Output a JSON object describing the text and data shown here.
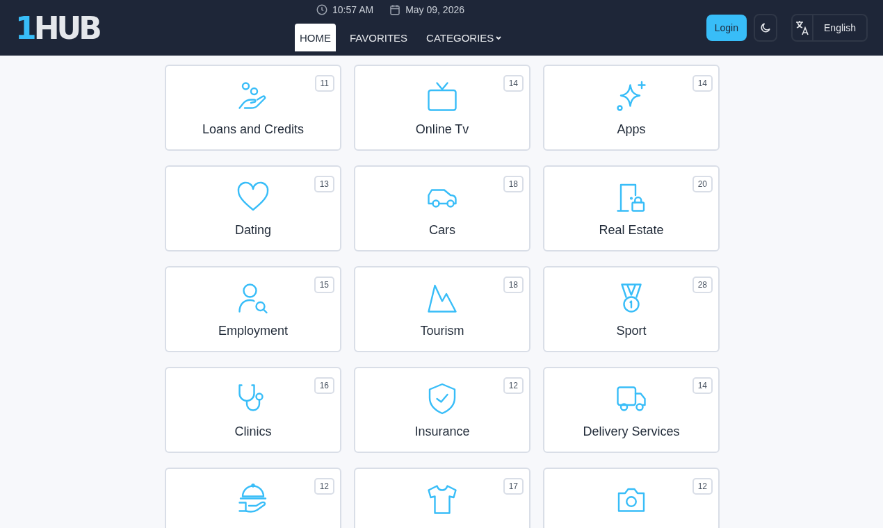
{
  "header": {
    "logo": {
      "accent": "1",
      "text": "HUB"
    },
    "time": "10:57 AM",
    "date": "May 09, 2026",
    "nav": [
      {
        "label": "HOME",
        "selected": true,
        "dropdown": false
      },
      {
        "label": "FAVORITES",
        "selected": false,
        "dropdown": false
      },
      {
        "label": "CATEGORIES",
        "selected": false,
        "dropdown": true
      }
    ],
    "login": "Login",
    "language": "English"
  },
  "categories": [
    {
      "label": "Loans and Credits",
      "count": "11"
    },
    {
      "label": "Online Tv",
      "count": "14"
    },
    {
      "label": "Apps",
      "count": "14"
    },
    {
      "label": "Dating",
      "count": "13"
    },
    {
      "label": "Cars",
      "count": "18"
    },
    {
      "label": "Real Estate",
      "count": "20"
    },
    {
      "label": "Employment",
      "count": "15"
    },
    {
      "label": "Tourism",
      "count": "18"
    },
    {
      "label": "Sport",
      "count": "28"
    },
    {
      "label": "Clinics",
      "count": "16"
    },
    {
      "label": "Insurance",
      "count": "12"
    },
    {
      "label": "Delivery Services",
      "count": "14"
    },
    {
      "count": "12"
    },
    {
      "count": "17"
    },
    {
      "count": "12"
    }
  ]
}
